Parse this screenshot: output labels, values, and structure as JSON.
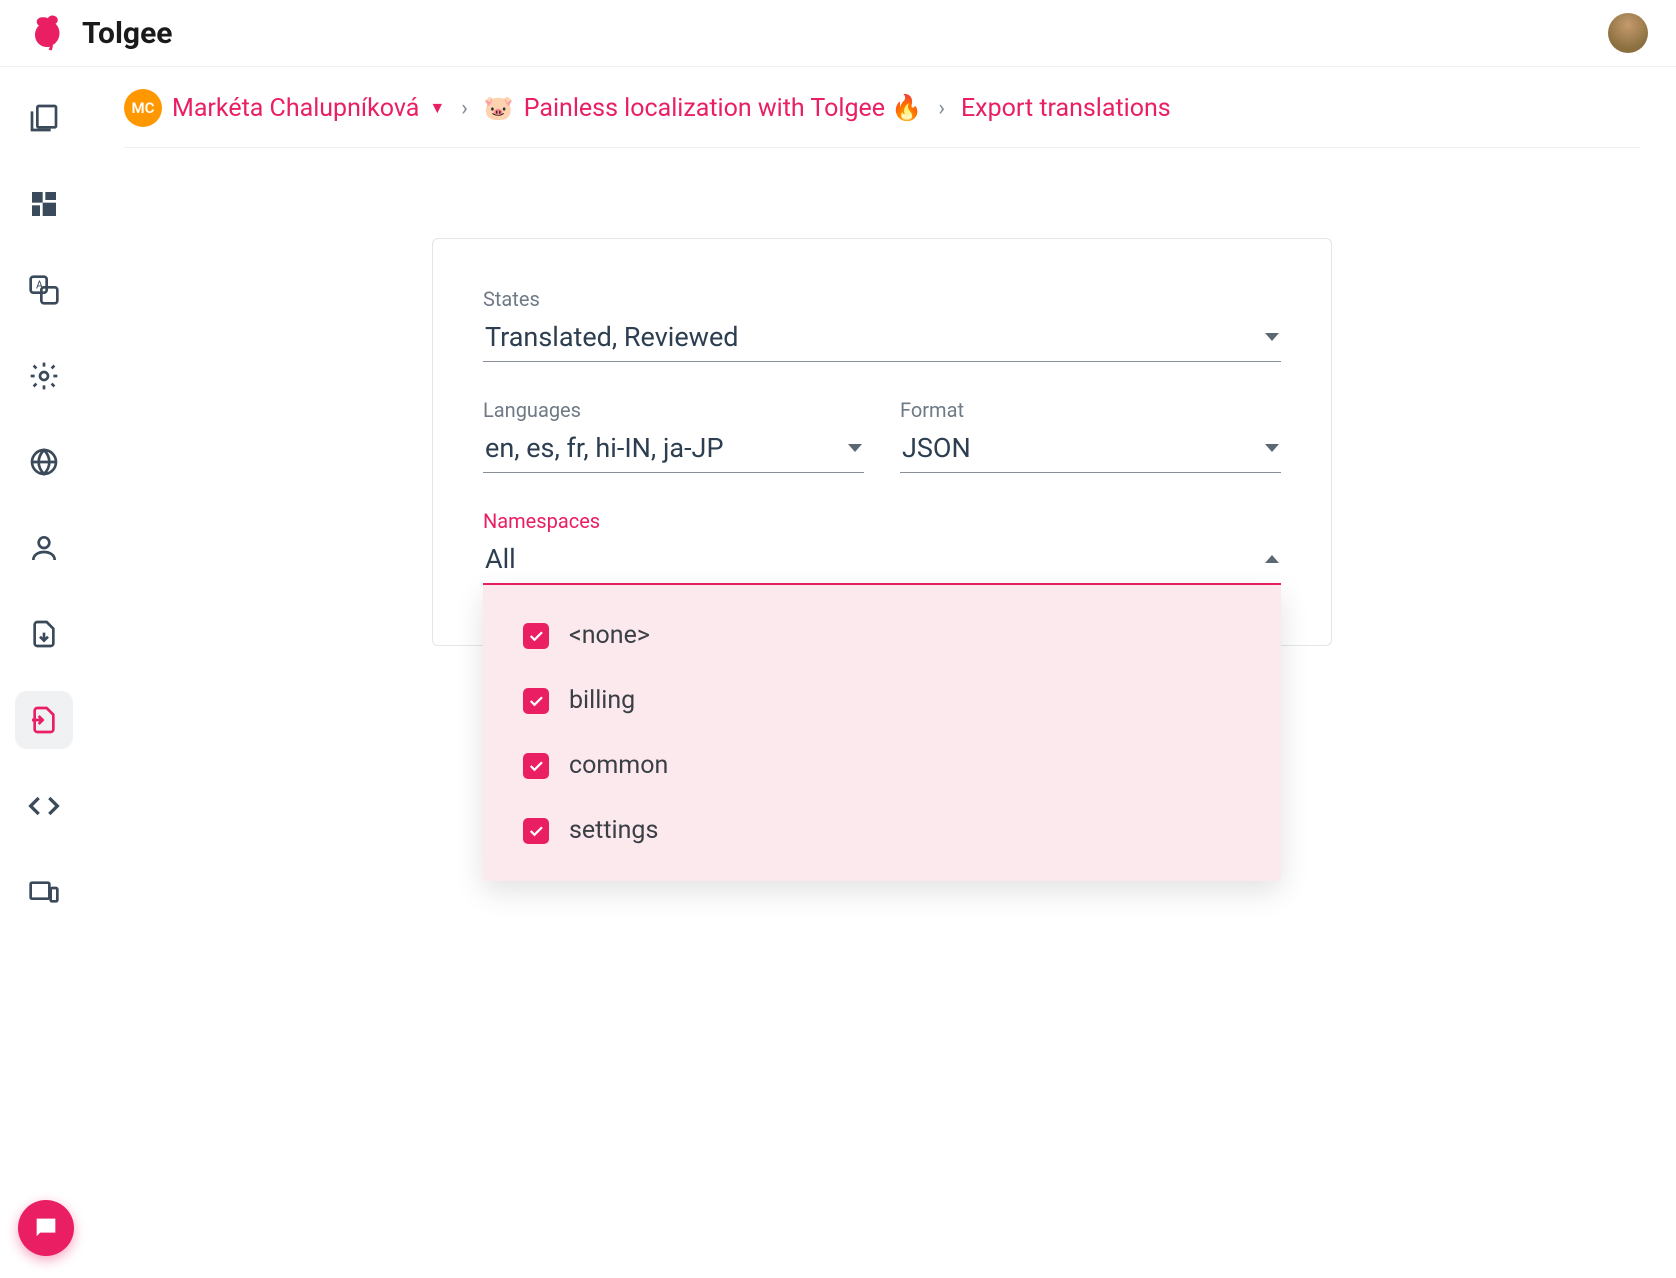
{
  "header": {
    "app_name": "Tolgee"
  },
  "breadcrumb": {
    "user_initials": "MC",
    "user_name": "Markéta Chalupníková",
    "project_emoji": "🐷",
    "project_name": "Painless localization with Tolgee 🔥",
    "page": "Export translations"
  },
  "form": {
    "states": {
      "label": "States",
      "value": "Translated, Reviewed"
    },
    "languages": {
      "label": "Languages",
      "value": "en, es, fr, hi-IN, ja-JP"
    },
    "format": {
      "label": "Format",
      "value": "JSON"
    },
    "namespaces": {
      "label": "Namespaces",
      "value": "All"
    }
  },
  "namespace_options": [
    {
      "label": "<none>",
      "checked": true
    },
    {
      "label": "billing",
      "checked": true
    },
    {
      "label": "common",
      "checked": true
    },
    {
      "label": "settings",
      "checked": true
    }
  ]
}
